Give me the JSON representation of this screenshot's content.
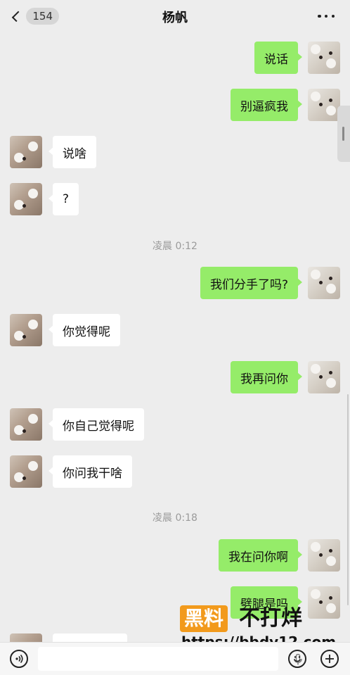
{
  "header": {
    "back_count": "154",
    "title": "杨帆",
    "more_icon": "more-dots-icon"
  },
  "messages": [
    {
      "side": "mine",
      "text": "说话"
    },
    {
      "side": "mine",
      "text": "别逼疯我"
    },
    {
      "side": "theirs",
      "text": "说啥"
    },
    {
      "side": "theirs",
      "text": "?"
    },
    {
      "side": "time",
      "text": "凌晨 0:12"
    },
    {
      "side": "mine",
      "text": "我们分手了吗?"
    },
    {
      "side": "theirs",
      "text": "你觉得呢"
    },
    {
      "side": "mine",
      "text": "我再问你"
    },
    {
      "side": "theirs",
      "text": "你自己觉得呢"
    },
    {
      "side": "theirs",
      "text": "你问我干啥"
    },
    {
      "side": "time",
      "text": "凌晨 0:18"
    },
    {
      "side": "mine",
      "text": "我在问你啊"
    },
    {
      "side": "mine",
      "text": "劈腿是吗"
    }
  ],
  "watermark": {
    "brand": "黑料",
    "slogan": "不打烊",
    "url": "https://bbdy12.com"
  },
  "input_bar": {
    "voice_icon": "voice-icon",
    "mic_icon": "mic-icon",
    "emoji_icon": "emoji-icon",
    "plus_icon": "plus-icon"
  },
  "colors": {
    "background": "#ededed",
    "mine_bubble": "#95ec69",
    "theirs_bubble": "#ffffff",
    "timestamp": "#9a9a9a"
  }
}
